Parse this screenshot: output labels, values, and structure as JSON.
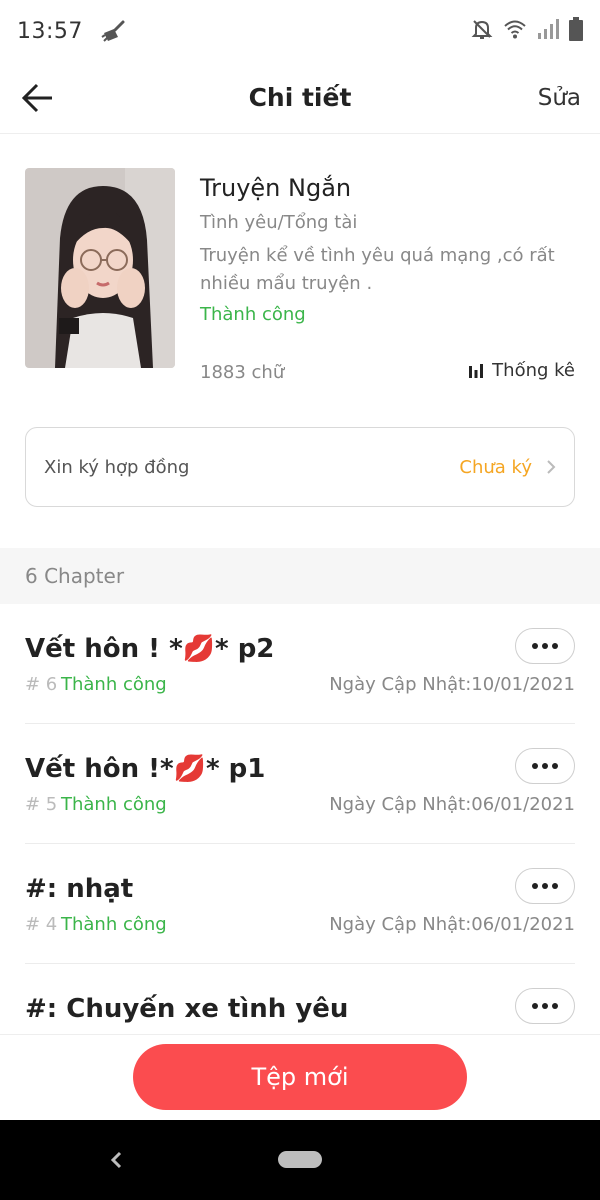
{
  "status_bar": {
    "time": "13:57",
    "icons": [
      "cleaner-icon",
      "mute-bell-icon",
      "wifi-icon",
      "signal-icon",
      "battery-icon"
    ]
  },
  "header": {
    "title": "Chi tiết",
    "edit_label": "Sửa",
    "back_icon": "back-arrow-icon"
  },
  "story": {
    "title": "Truyện Ngắn",
    "genre": "Tình yêu/Tổng tài",
    "description": "Truyện kể về tình yêu quá mạng ,có rất nhiều mẩu truyện .",
    "status": "Thành công",
    "word_count": "1883 chữ",
    "stats_label": "Thống kê",
    "cover_icon": "story-cover-photo"
  },
  "contract": {
    "label": "Xin ký hợp đồng",
    "status": "Chưa ký"
  },
  "chapters_header": "6 Chapter",
  "chapters": [
    {
      "title": "Vết hôn ! *💋* p2",
      "number": "# 6",
      "status": "Thành công",
      "date": "Ngày Cập Nhật:10/01/2021"
    },
    {
      "title": "Vết hôn !*💋* p1",
      "number": "# 5",
      "status": "Thành công",
      "date": "Ngày Cập Nhật:06/01/2021"
    },
    {
      "title": "#: nhạt",
      "number": "# 4",
      "status": "Thành công",
      "date": "Ngày Cập Nhật:06/01/2021"
    },
    {
      "title": "#: Chuyến xe tình yêu",
      "number": "",
      "status": "",
      "date": ""
    }
  ],
  "bottom_button": "Tệp mới",
  "colors": {
    "accent_red": "#fb4c4f",
    "success_green": "#3bb54a",
    "warning_orange": "#f5a623"
  }
}
